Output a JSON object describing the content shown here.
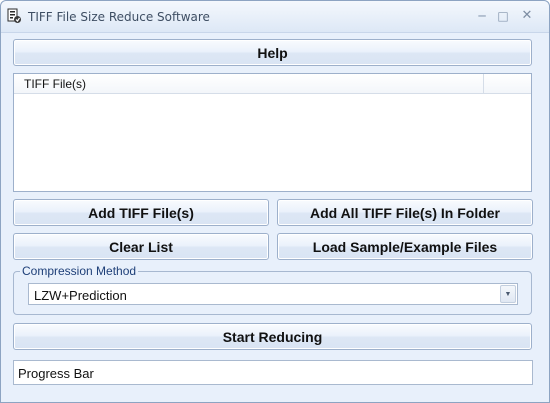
{
  "window": {
    "title": "TIFF File Size Reduce Software",
    "min_symbol": "─",
    "max_symbol": "□",
    "close_symbol": "✕"
  },
  "help_label": "Help",
  "file_list": {
    "columns": [
      "TIFF File(s)"
    ],
    "rows": []
  },
  "buttons": {
    "add_files": "Add TIFF File(s)",
    "add_folder": "Add All TIFF File(s) In Folder",
    "clear_list": "Clear List",
    "load_sample": "Load Sample/Example Files",
    "start": "Start Reducing"
  },
  "compression": {
    "legend": "Compression Method",
    "selected": "LZW+Prediction",
    "arrow": "▼"
  },
  "progress": {
    "label": "Progress Bar",
    "fraction": 0
  },
  "icons": {
    "app": "tiff-app-icon",
    "dropdown": "chevron-down-icon"
  },
  "colors": {
    "window_bg": "#e8f0fb",
    "border": "#9db0cb",
    "legend_text": "#1e3f78"
  }
}
